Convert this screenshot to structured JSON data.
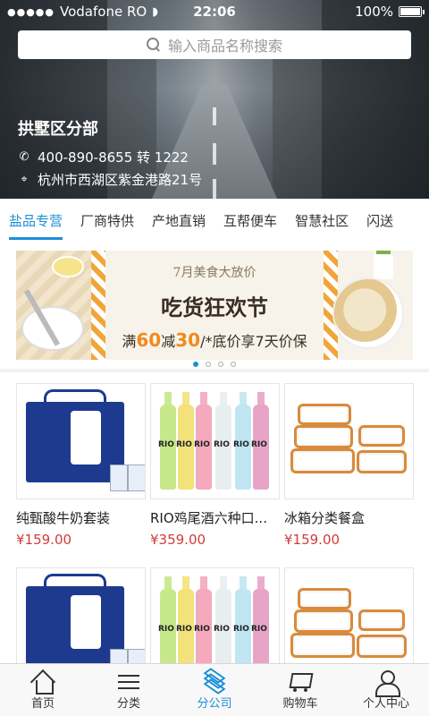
{
  "status_bar": {
    "carrier": "Vodafone RO",
    "time": "22:06",
    "battery": "100%"
  },
  "search": {
    "placeholder": "输入商品名称搜索"
  },
  "branch": {
    "name": "拱墅区分部",
    "phone": "400-890-8655 转 1222",
    "address": "杭州市西湖区紫金港路21号"
  },
  "category_tabs": [
    "盐品专营",
    "厂商特供",
    "产地直销",
    "互帮便车",
    "智慧社区",
    "闪送"
  ],
  "banner": {
    "subtitle": "7月美食大放价",
    "title": "吃货狂欢节",
    "promo_prefix": "满",
    "promo_num1": "60",
    "promo_mid": "减",
    "promo_num2": "30",
    "promo_suffix": "/*底价享7天价保",
    "page_count": 4,
    "active_page": 1
  },
  "products": [
    {
      "name": "纯甄酸牛奶套装",
      "price": "¥159.00",
      "image": "milk-gift-box"
    },
    {
      "name": "RIO鸡尾酒六种口...",
      "price": "¥359.00",
      "image": "rio-cocktail-bottles"
    },
    {
      "name": "冰箱分类餐盒",
      "price": "¥159.00",
      "image": "glass-food-containers"
    },
    {
      "name": "",
      "price": "",
      "image": "milk-gift-box"
    },
    {
      "name": "",
      "price": "",
      "image": "rio-cocktail-bottles"
    },
    {
      "name": "",
      "price": "",
      "image": "glass-food-containers"
    }
  ],
  "tabbar": {
    "items": [
      {
        "label": "首页",
        "icon": "home-icon"
      },
      {
        "label": "分类",
        "icon": "list-icon"
      },
      {
        "label": "分公司",
        "icon": "layers-icon",
        "active": true
      },
      {
        "label": "购物车",
        "icon": "cart-icon"
      },
      {
        "label": "个人中心",
        "icon": "user-icon"
      }
    ]
  },
  "colors": {
    "accent": "#1a8fd6",
    "price": "#d13b3b",
    "promo": "#f08a1c"
  }
}
